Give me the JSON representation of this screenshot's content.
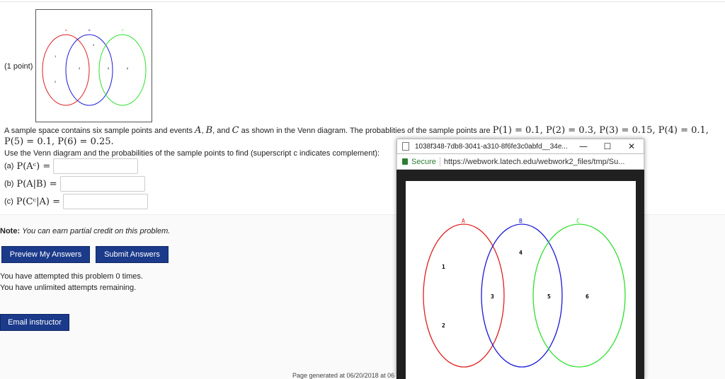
{
  "problem": {
    "points_label": "(1 point)",
    "statement_prefix": "A sample space contains six sample points and events ",
    "event_A": "A",
    "event_B": "B",
    "event_C": "C",
    "statement_mid": ", and ",
    "statement_suffix": " as shown in the Venn diagram. The probablities of the sample points are ",
    "probs_line1": "P(1) = 0.1, P(2) = 0.3, P(3) = 0.15, P(4) = 0.1,",
    "probs_line2": "P(5) = 0.1, P(6) = 0.25.",
    "instruction": "Use the Venn diagram and the probabilities of the sample points to find (superscript c indicates complement):",
    "questions": [
      {
        "label": "(a)",
        "expr": "P(Aᶜ) =",
        "value": ""
      },
      {
        "label": "(b)",
        "expr": "P(A|B) =",
        "value": ""
      },
      {
        "label": "(c)",
        "expr": "P(Cᶜ|A) =",
        "value": ""
      }
    ]
  },
  "venn": {
    "set_labels": [
      "A",
      "B",
      "C"
    ],
    "points": [
      "1",
      "2",
      "3",
      "4",
      "5",
      "6"
    ],
    "colors": {
      "A": "#e02020",
      "B": "#1a1ad8",
      "C": "#2ee02e"
    }
  },
  "note": {
    "bold": "Note:",
    "text": "You can earn partial credit on this problem."
  },
  "buttons": {
    "preview": "Preview My Answers",
    "submit": "Submit Answers",
    "email": "Email instructor"
  },
  "attempts": {
    "line1": "You have attempted this problem 0 times.",
    "line2": "You have unlimited attempts remaining."
  },
  "footer": "Page generated at 06/20/2018 at 06",
  "popup": {
    "title": "1038f348-7db8-3041-a310-8f6fe3c0abfd__34e...",
    "minimize": "—",
    "maximize": "☐",
    "close": "✕",
    "secure": "Secure",
    "url": "https://webwork.latech.edu/webwork2_files/tmp/Su..."
  }
}
